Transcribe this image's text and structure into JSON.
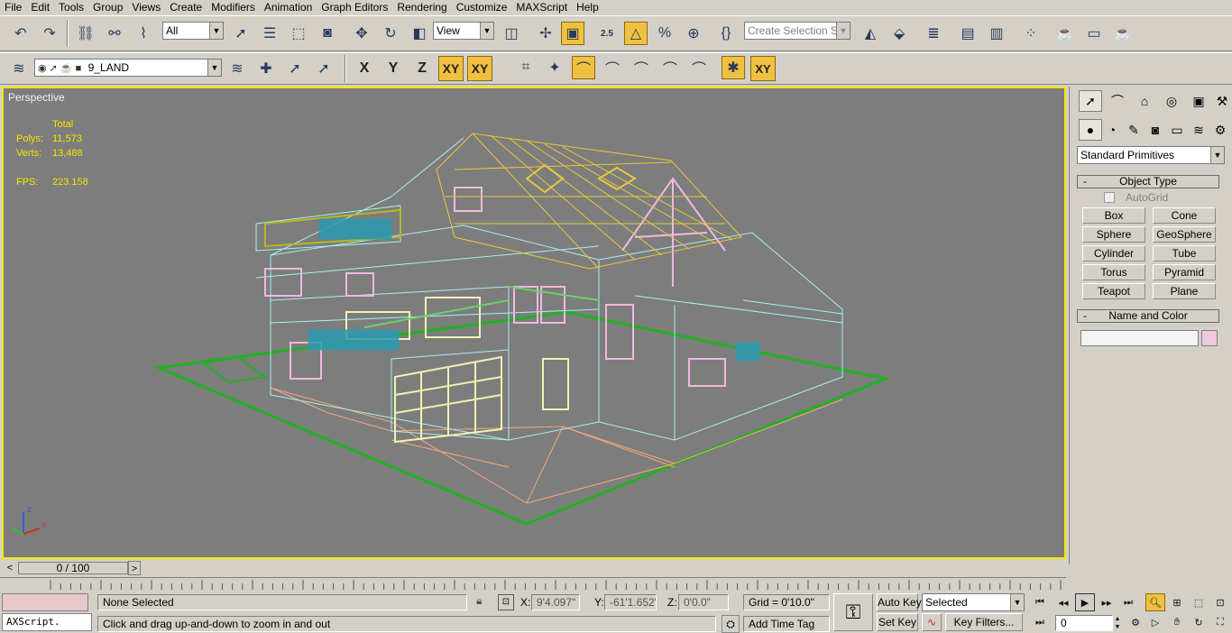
{
  "menu": [
    "File",
    "Edit",
    "Tools",
    "Group",
    "Views",
    "Create",
    "Modifiers",
    "Animation",
    "Graph Editors",
    "Rendering",
    "Customize",
    "MAXScript",
    "Help"
  ],
  "toolbar1": {
    "selection_filter": "All",
    "ref_coord": "View",
    "snap_angle": "2.5",
    "named_selection_placeholder": "Create Selection Set"
  },
  "toolbar2": {
    "layer_name": "9_LAND",
    "axis_x": "X",
    "axis_y": "Y",
    "axis_z": "Z",
    "axis_xy": "XY",
    "axis_xy2": "XY"
  },
  "viewport": {
    "label": "Perspective",
    "stats_header": "Total",
    "polys_label": "Polys:",
    "polys_value": "11,573",
    "verts_label": "Verts:",
    "verts_value": "13,488",
    "fps_label": "FPS:",
    "fps_value": "223.158",
    "axis_z": "z",
    "axis_x": "x"
  },
  "command_panel": {
    "category": "Standard Primitives",
    "object_type_title": "Object Type",
    "autogrid_label": "AutoGrid",
    "buttons": [
      "Box",
      "Cone",
      "Sphere",
      "GeoSphere",
      "Cylinder",
      "Tube",
      "Torus",
      "Pyramid",
      "Teapot",
      "Plane"
    ],
    "name_color_title": "Name and Color",
    "name_value": "",
    "color": "#f0c8e0"
  },
  "timeline": {
    "slider_text": "0 / 100",
    "prev": "<",
    "next": ">"
  },
  "status": {
    "maxscript_label": "AXScript.",
    "selection": "None Selected",
    "prompt": "Click and drag up-and-down to zoom in and out",
    "x_label": "X:",
    "x_value": "9'4.097\"",
    "y_label": "Y:",
    "y_value": "-61'1.652\"",
    "z_label": "Z:",
    "z_value": "0'0.0\"",
    "grid": "Grid = 0'10.0\"",
    "add_time_tag": "Add Time Tag",
    "auto_key": "Auto Key",
    "set_key": "Set Key",
    "key_mode": "Selected",
    "key_filters": "Key Filters...",
    "frame": "0"
  },
  "colors": {
    "viewport_bg": "#7d7d7d",
    "active_border": "#f5e600",
    "active_button": "#f0c040",
    "stats_text": "#f5e600"
  }
}
